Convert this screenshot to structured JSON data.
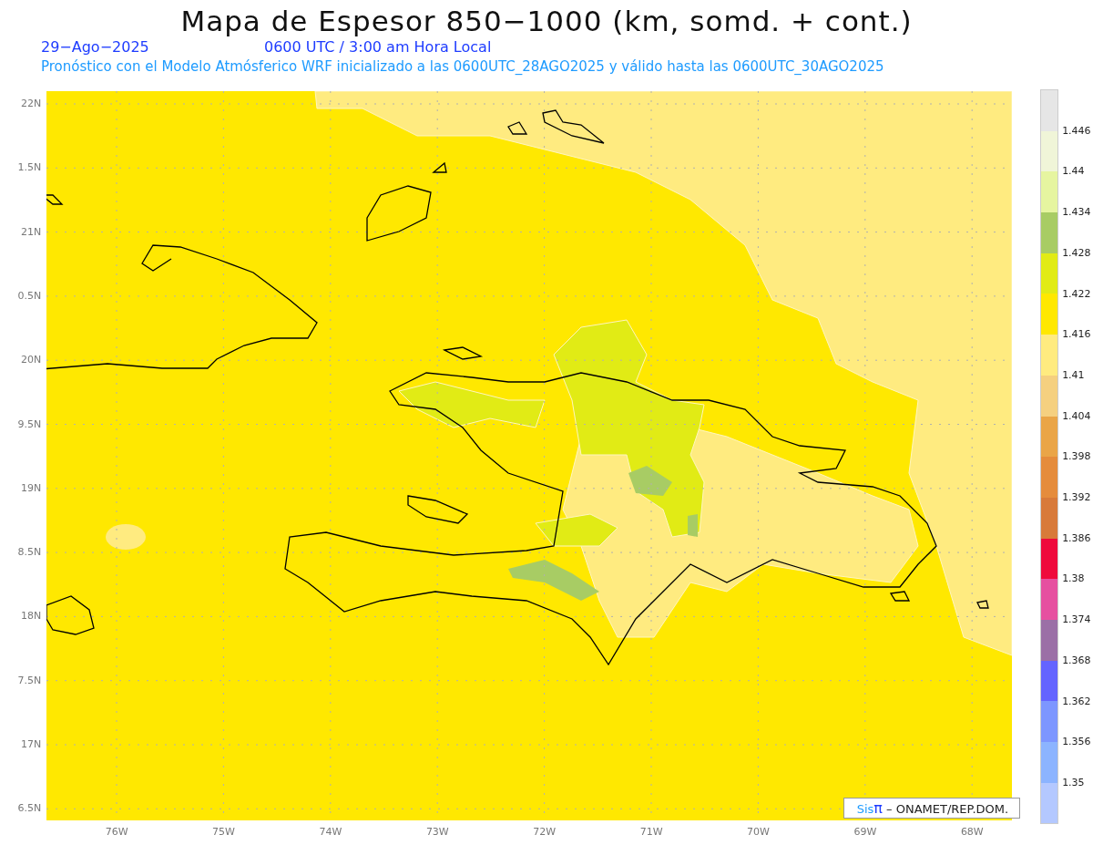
{
  "title": "Mapa de Espesor 850−1000 (km, somd. + cont.)",
  "date": "29−Ago−2025",
  "time": "0600 UTC / 3:00 am Hora Local",
  "forecast": "Pronóstico con el Modelo Atmósferico WRF inicializado a las 0600UTC_28AGO2025 y válido hasta las  0600UTC_30AGO2025",
  "map": {
    "y_ticks": [
      "22N",
      "1.5N",
      "21N",
      "0.5N",
      "20N",
      "9.5N",
      "19N",
      "8.5N",
      "18N",
      "7.5N",
      "17N",
      "6.5N"
    ],
    "x_ticks": [
      "76W",
      "75W",
      "74W",
      "73W",
      "72W",
      "71W",
      "70W",
      "69W",
      "68W"
    ],
    "credit": {
      "brand": "Sis",
      "symbol": "π",
      "text": "– ONAMET/REP.DOM."
    }
  },
  "colorbar": {
    "bins": [
      {
        "color": "#e6e6e6"
      },
      {
        "color": "#f0f5d8"
      },
      {
        "color": "#e6f5a0"
      },
      {
        "color": "#a8cc64"
      },
      {
        "color": "#e1eb15"
      },
      {
        "color": "#ffe800"
      },
      {
        "color": "#ffeb80"
      },
      {
        "color": "#f5d080"
      },
      {
        "color": "#eaa547"
      },
      {
        "color": "#e58c3c"
      },
      {
        "color": "#d87a3a"
      },
      {
        "color": "#ef0a3c"
      },
      {
        "color": "#e650a0"
      },
      {
        "color": "#9b6fa6"
      },
      {
        "color": "#6464ff"
      },
      {
        "color": "#7d96ff"
      },
      {
        "color": "#8cb4ff"
      },
      {
        "color": "#b4c8ff"
      }
    ],
    "labels": [
      "1.446",
      "1.44",
      "1.434",
      "1.428",
      "1.422",
      "1.416",
      "1.41",
      "1.404",
      "1.398",
      "1.392",
      "1.386",
      "1.38",
      "1.374",
      "1.368",
      "1.362",
      "1.356",
      "1.35"
    ]
  }
}
